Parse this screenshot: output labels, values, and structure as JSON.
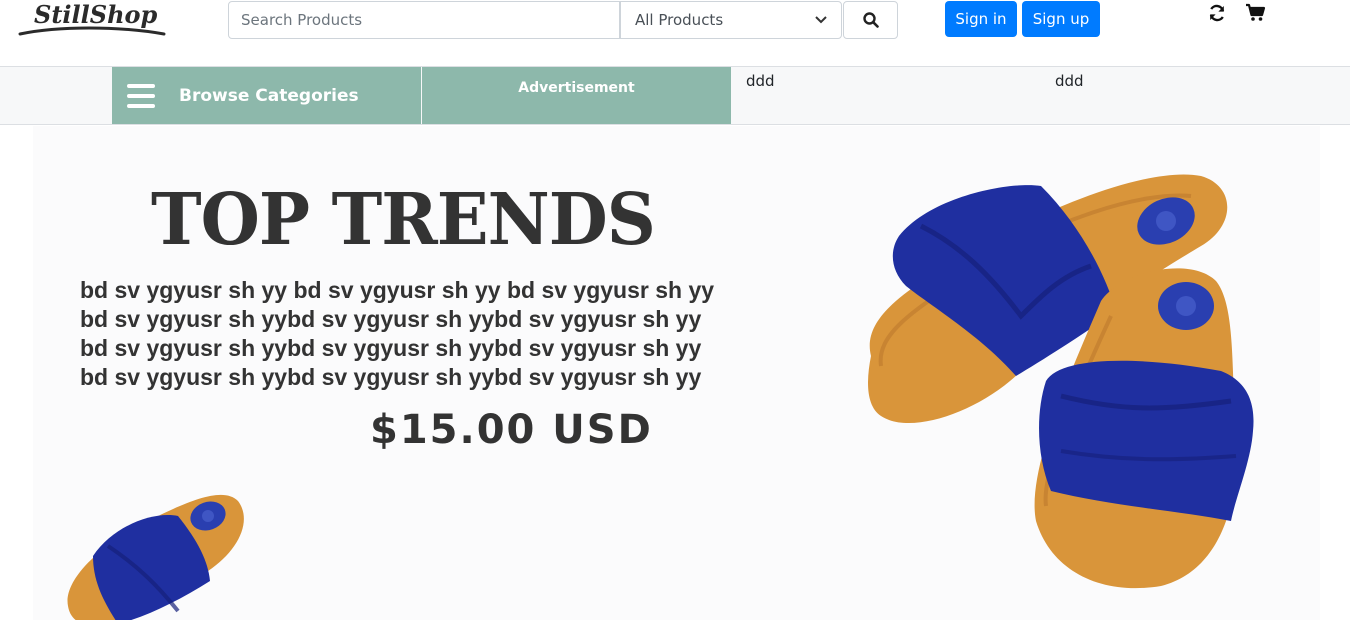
{
  "header": {
    "logo_text": "StillShop",
    "search_placeholder": "Search Products",
    "category_selected": "All Products",
    "signin_label": "Sign in",
    "signup_label": "Sign up"
  },
  "nav": {
    "browse_label": "Browse Categories",
    "advert_label": "Advertisement",
    "text_1": "ddd",
    "text_2": "ddd"
  },
  "hero": {
    "title": "TOP TRENDS",
    "desc_lines": [
      "bd  sv ygyusr sh yy bd  sv ygyusr sh yy bd  sv ygyusr sh yy",
      "bd  sv ygyusr sh yybd  sv ygyusr sh yybd  sv ygyusr sh yy",
      "bd  sv ygyusr sh yybd  sv ygyusr sh yybd  sv ygyusr sh yy",
      "bd  sv ygyusr sh yybd  sv ygyusr sh yybd  sv ygyusr sh yy"
    ],
    "price": "$15.00 USD"
  },
  "colors": {
    "accent_blue": "#007bff",
    "nav_green": "#8db8ab",
    "sandal_strap": "#1f2fa0",
    "sandal_sole": "#d9953a"
  },
  "icons": [
    "search-icon",
    "refresh-icon",
    "cart-icon",
    "hamburger-icon",
    "chevron-down-icon"
  ]
}
